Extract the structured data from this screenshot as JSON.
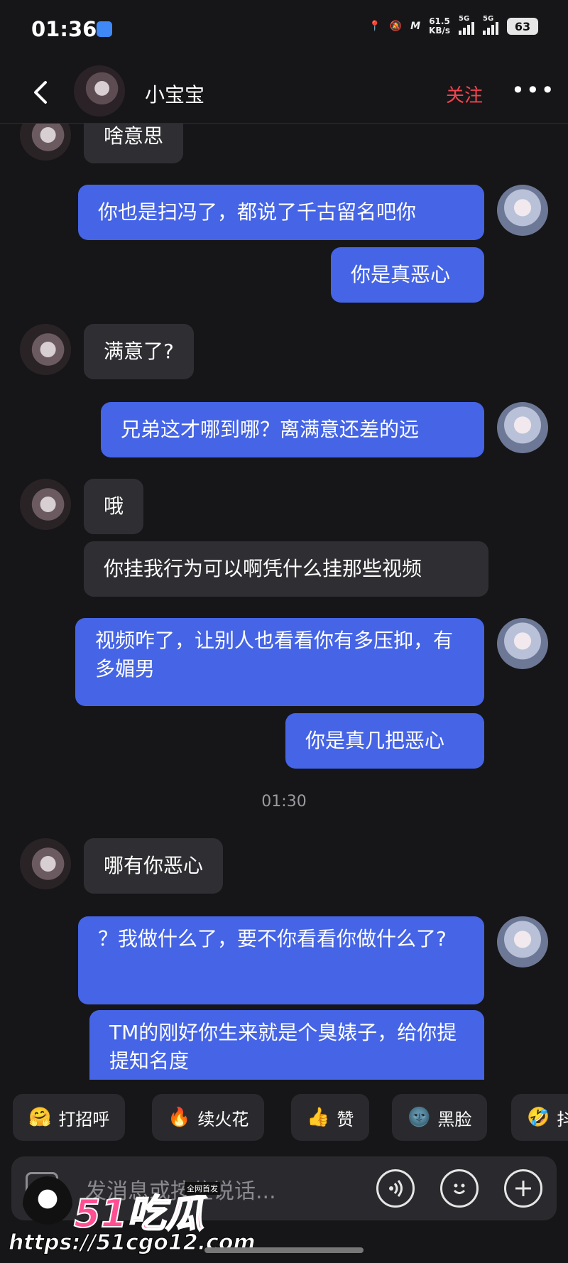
{
  "status_bar": {
    "time": "01:36",
    "speed_value": "61.5",
    "speed_unit": "KB/s",
    "sim1": "5G",
    "sim2": "5G",
    "battery": "63"
  },
  "header": {
    "name": "小宝宝",
    "follow_label": "关注",
    "more_label": "•••"
  },
  "messages": [
    {
      "from": "them",
      "text": "啥意思"
    },
    {
      "from": "me",
      "text": "你也是扫冯了，都说了千古留名吧你"
    },
    {
      "from": "me",
      "text": "你是真恶心"
    },
    {
      "from": "them",
      "text": "满意了?"
    },
    {
      "from": "me",
      "text": "兄弟这才哪到哪？离满意还差的远"
    },
    {
      "from": "them",
      "text": "哦"
    },
    {
      "from": "them",
      "text": "你挂我行为可以啊凭什么挂那些视频"
    },
    {
      "from": "me",
      "text": "视频咋了，让别人也看看你有多压抑，有多媚男"
    },
    {
      "from": "me",
      "text": "你是真几把恶心"
    },
    {
      "from": "them",
      "text": "哪有你恶心"
    },
    {
      "from": "me",
      "text": "？我做什么了，要不你看看你做什么了?"
    },
    {
      "from": "me",
      "text": "TM的刚好你生来就是个臭婊子，给你提提知名度"
    }
  ],
  "timestamp": "01:30",
  "quick_actions": [
    {
      "icon": "🤗",
      "label": "打招呼"
    },
    {
      "icon": "🔥",
      "label": "续火花"
    },
    {
      "icon": "👍",
      "label": "赞"
    },
    {
      "icon": "🌚",
      "label": "黑脸"
    },
    {
      "icon": "🤣",
      "label": "抖"
    }
  ],
  "input": {
    "placeholder": "发消息或按住说话..."
  },
  "watermark": {
    "brand": "51吃瓜",
    "tag": "全网首发",
    "url": "https://51cgo12.com"
  },
  "colors": {
    "background": "#161618",
    "my_bubble": "#4564e6",
    "their_bubble": "#2f2f33",
    "follow": "#f0454f"
  }
}
